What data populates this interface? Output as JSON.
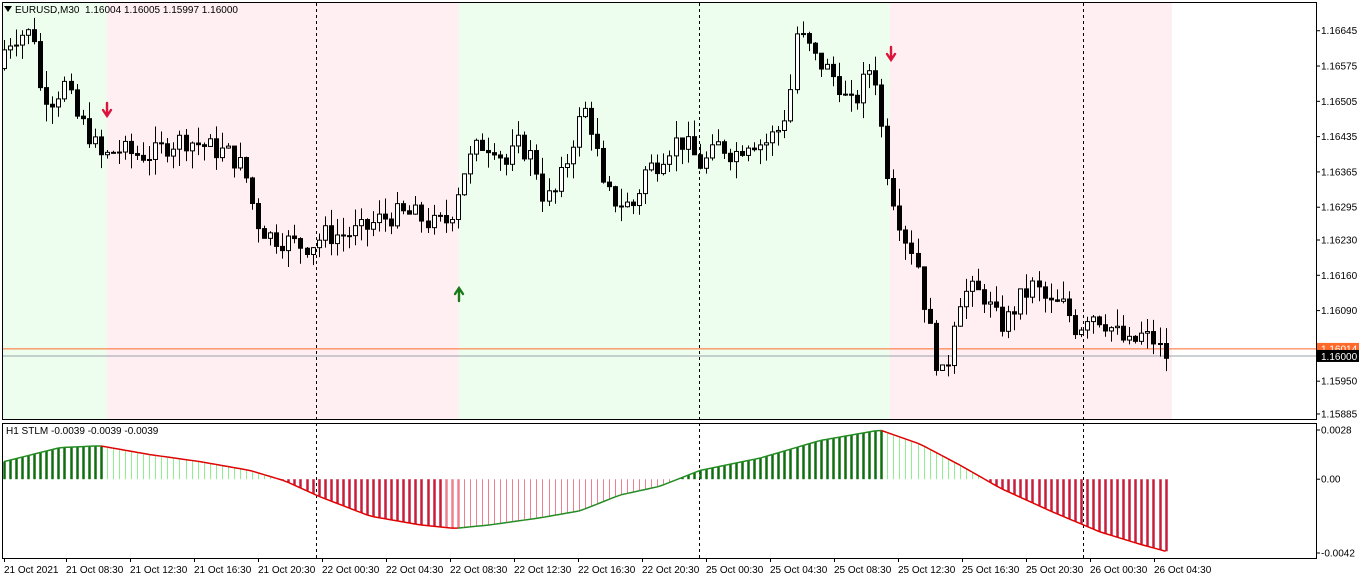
{
  "header": {
    "symbol_label": "EURUSD,M30",
    "ohlc": "1.16004 1.16005 1.15997 1.16000"
  },
  "indicator": {
    "label": "H1 STLM -0.0039 -0.0039 -0.0039",
    "scale_labels": [
      "0.0028",
      "0.00",
      "-0.0042"
    ],
    "scale_values": [
      0.0028,
      0.0,
      -0.0042
    ]
  },
  "price_axis": {
    "labels": [
      "1.16645",
      "1.16575",
      "1.16505",
      "1.16435",
      "1.16365",
      "1.16295",
      "1.16230",
      "1.16160",
      "1.16090",
      "1.15950",
      "1.15885"
    ],
    "values": [
      1.16645,
      1.16575,
      1.16505,
      1.16435,
      1.16365,
      1.16295,
      1.1623,
      1.1616,
      1.1609,
      1.1595,
      1.15885
    ],
    "current_price_label": "1.16000",
    "current_price": 1.16,
    "stop_price_label": "1.16014",
    "stop_price": 1.16014
  },
  "time_axis": {
    "labels": [
      "21 Oct 2021",
      "21 Oct 08:30",
      "21 Oct 12:30",
      "21 Oct 16:30",
      "21 Oct 20:30",
      "22 Oct 00:30",
      "22 Oct 04:30",
      "22 Oct 08:30",
      "22 Oct 12:30",
      "22 Oct 16:30",
      "22 Oct 20:30",
      "25 Oct 00:30",
      "25 Oct 04:30",
      "25 Oct 08:30",
      "25 Oct 12:30",
      "25 Oct 16:30",
      "25 Oct 20:30",
      "26 Oct 00:30",
      "26 Oct 04:30"
    ]
  },
  "colors": {
    "bull_zone": "#eefeee",
    "bear_zone": "#ffeef2",
    "up_arrow": "#1a7a1a",
    "down_arrow": "#dc143c",
    "hist_up_dark": "#0f6e0f",
    "hist_up_light": "#90ee90",
    "hist_down_dark": "#c81e3c",
    "hist_down_light": "#f08090",
    "signal_line_up": "#228b22",
    "signal_line_down": "#e00000",
    "price_line": "#ff6a2a",
    "current_bg": "#000000"
  },
  "signals": [
    {
      "type": "sell-arrow",
      "time": "21 Oct 08:30"
    },
    {
      "type": "buy-arrow",
      "time": "22 Oct 08:30"
    },
    {
      "type": "sell-arrow",
      "time": "25 Oct 08:30"
    }
  ],
  "chart_data": {
    "type": "candlestick",
    "symbol": "EURUSD",
    "timeframe": "M30",
    "ylim": [
      1.1588,
      1.167
    ],
    "ohlc_approx": [
      [
        1.1657,
        1.166,
        1.1652,
        1.1655
      ],
      [
        1.1661,
        1.1665,
        1.1654,
        1.1663
      ],
      [
        1.1664,
        1.1666,
        1.166,
        1.1662
      ],
      [
        1.1662,
        1.1668,
        1.1659,
        1.1664
      ],
      [
        1.1665,
        1.1668,
        1.166,
        1.1663
      ],
      [
        1.1664,
        1.1665,
        1.1652,
        1.1653
      ],
      [
        1.1653,
        1.1655,
        1.1648,
        1.1649
      ],
      [
        1.1649,
        1.1651,
        1.1646,
        1.165
      ],
      [
        1.165,
        1.1652,
        1.1645,
        1.1648
      ],
      [
        1.1648,
        1.1656,
        1.1647,
        1.1653
      ],
      [
        1.1653,
        1.1655,
        1.1644,
        1.1645
      ],
      [
        1.1645,
        1.1648,
        1.164,
        1.1641
      ],
      [
        1.1641,
        1.1643,
        1.1636,
        1.1642
      ],
      [
        1.1642,
        1.1644,
        1.1635,
        1.1636
      ],
      [
        1.1636,
        1.1642,
        1.1635,
        1.164
      ],
      [
        1.164,
        1.1643,
        1.1638,
        1.1642
      ],
      [
        1.1642,
        1.1646,
        1.1639,
        1.164
      ],
      [
        1.164,
        1.1644,
        1.1637,
        1.1643
      ],
      [
        1.1643,
        1.1645,
        1.1638,
        1.1641
      ],
      [
        1.1641,
        1.1644,
        1.1639,
        1.1642
      ],
      [
        1.1642,
        1.1644,
        1.1638,
        1.164
      ],
      [
        1.164,
        1.1645,
        1.1638,
        1.1642
      ],
      [
        1.1642,
        1.1644,
        1.164,
        1.1643
      ],
      [
        1.1643,
        1.1647,
        1.1637,
        1.1639
      ],
      [
        1.1639,
        1.1644,
        1.1636,
        1.1643
      ],
      [
        1.1643,
        1.1647,
        1.1639,
        1.1642
      ],
      [
        1.1642,
        1.165,
        1.1641,
        1.1643
      ],
      [
        1.1643,
        1.1646,
        1.1639,
        1.1644
      ],
      [
        1.1644,
        1.1648,
        1.1641,
        1.1641
      ],
      [
        1.1641,
        1.165,
        1.1637,
        1.1646
      ],
      [
        1.1646,
        1.1651,
        1.1643,
        1.164
      ],
      [
        1.164,
        1.1644,
        1.1636,
        1.1642
      ],
      [
        1.1642,
        1.1643,
        1.1637,
        1.1638
      ],
      [
        1.1638,
        1.1641,
        1.1634,
        1.1637
      ],
      [
        1.1637,
        1.1641,
        1.1634,
        1.164
      ],
      [
        1.164,
        1.1642,
        1.1632,
        1.1634
      ],
      [
        1.1634,
        1.1636,
        1.1625,
        1.1626
      ],
      [
        1.1626,
        1.163,
        1.1621,
        1.1622
      ],
      [
        1.1622,
        1.1626,
        1.162,
        1.1625
      ],
      [
        1.1625,
        1.1627,
        1.1621,
        1.1623
      ],
      [
        1.1623,
        1.1626,
        1.162,
        1.1622
      ],
      [
        1.1622,
        1.1624,
        1.1619,
        1.1621
      ],
      [
        1.1621,
        1.1624,
        1.1618,
        1.1622
      ],
      [
        1.1622,
        1.1624,
        1.1619,
        1.162
      ],
      [
        1.162,
        1.1625,
        1.1618,
        1.1622
      ]
    ],
    "indicator": {
      "name": "STLM",
      "timeframe": "H1",
      "values": [
        -0.0039,
        -0.0039,
        -0.0039
      ],
      "range": [
        -0.0042,
        0.0028
      ]
    }
  }
}
